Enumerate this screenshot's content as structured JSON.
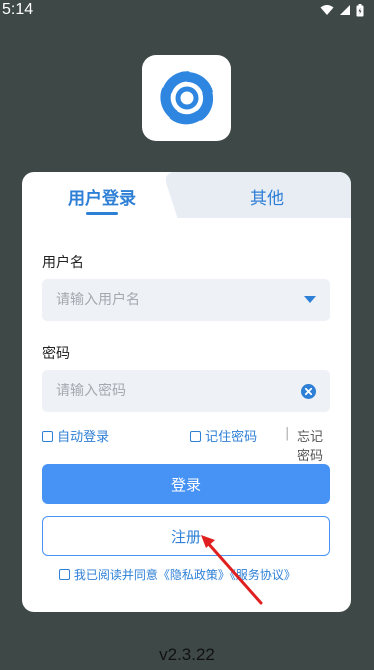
{
  "status_bar": {
    "time": "5:14",
    "icons": [
      "wifi-icon",
      "signal-icon",
      "battery-icon"
    ]
  },
  "app": {
    "logo": "app-logo",
    "version": "v2.3.22"
  },
  "tabs": {
    "login": "用户登录",
    "other": "其他"
  },
  "form": {
    "username_label": "用户名",
    "username_placeholder": "请输入用户名",
    "password_label": "密码",
    "password_placeholder": "请输入密码",
    "auto_login": "自动登录",
    "remember_password": "记住密码",
    "separator": "|",
    "forgot_password": "忘记密码",
    "login_button": "登录",
    "register_button": "注册",
    "agreement": "我已阅读并同意《隐私政策》《服务协议》"
  },
  "colors": {
    "background": "#3e4847",
    "accent": "#4793f5",
    "annotation": "#e02020"
  }
}
